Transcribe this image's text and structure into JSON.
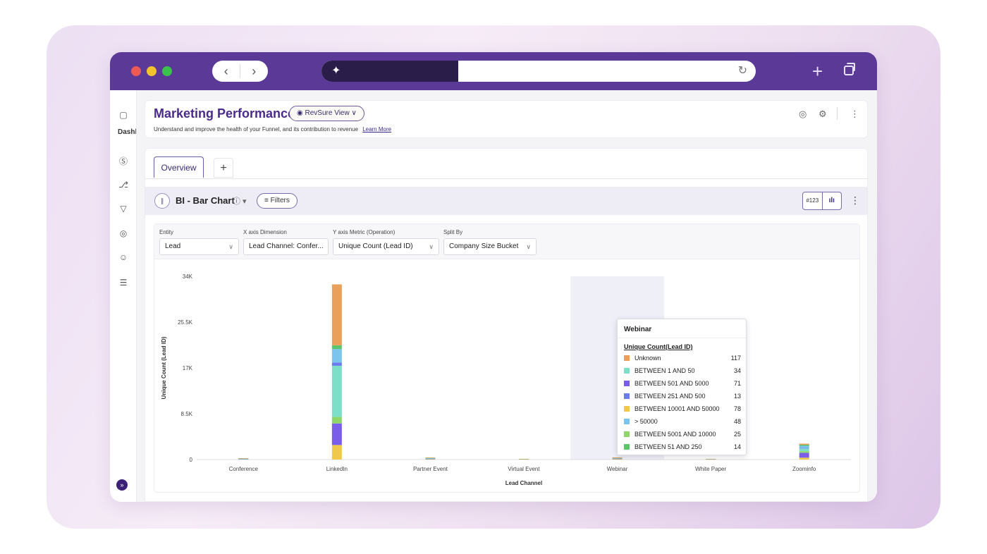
{
  "app": {
    "title": "Marketing Performance",
    "view_pill": "RevSure View",
    "subtitle": "Understand and improve the health of your Funnel, and its contribution to revenue",
    "learn_more": "Learn More"
  },
  "sidebar": {
    "label": "Dashl",
    "icons": [
      "home-icon",
      "dollar-icon",
      "branch-icon",
      "filter-icon",
      "target-icon",
      "users-icon",
      "database-icon",
      "expand-icon"
    ]
  },
  "tabs": [
    {
      "label": "Overview",
      "active": true
    },
    {
      "label": "+",
      "active": false
    }
  ],
  "chart_header": {
    "title": "BI - Bar Chart",
    "filters_label": "Filters",
    "toggle_number": "#123",
    "toggle_chart": "ılı"
  },
  "controls": {
    "entity": {
      "label": "Entity",
      "value": "Lead"
    },
    "x_axis": {
      "label": "X axis Dimension",
      "value": "Lead Channel: Confer..."
    },
    "y_axis": {
      "label": "Y axis Metric (Operation)",
      "value": "Unique Count (Lead ID)"
    },
    "split": {
      "label": "Split By",
      "value": "Company Size Bucket"
    }
  },
  "tooltip": {
    "title": "Webinar",
    "metric": "Unique Count(Lead ID)",
    "rows": [
      {
        "name": "Unknown",
        "value": "117",
        "color": "#e9a05a"
      },
      {
        "name": "BETWEEN 1 AND 50",
        "value": "34",
        "color": "#7ddfc8"
      },
      {
        "name": "BETWEEN 501 AND 5000",
        "value": "71",
        "color": "#7a5de8"
      },
      {
        "name": "BETWEEN 251 AND 500",
        "value": "13",
        "color": "#6a7bee"
      },
      {
        "name": "BETWEEN 10001 AND 50000",
        "value": "78",
        "color": "#f0c94a"
      },
      {
        "name": "> 50000",
        "value": "48",
        "color": "#7ac4ee"
      },
      {
        "name": "BETWEEN 5001 AND 10000",
        "value": "25",
        "color": "#8ed66a"
      },
      {
        "name": "BETWEEN 51 AND 250",
        "value": "14",
        "color": "#5cc46a"
      }
    ]
  },
  "colors": {
    "brand": "#5b3a97",
    "accent": "#4a2a8a",
    "highlight_band": "#efeff8"
  },
  "chart_data": {
    "type": "bar",
    "stacked": true,
    "xlabel": "Lead Channel",
    "ylabel": "Unique Count (Lead ID)",
    "ylim": [
      0,
      34000
    ],
    "yticks": [
      "0",
      "8.5K",
      "17K",
      "25.5K",
      "34K"
    ],
    "ytick_values": [
      0,
      8500,
      17000,
      25500,
      34000
    ],
    "categories": [
      "Conference",
      "LinkedIn",
      "Partner Event",
      "Virtual Event",
      "Webinar",
      "White Paper",
      "Zoominfo"
    ],
    "highlighted_category": "Webinar",
    "series": [
      {
        "name": "BETWEEN 10001 AND 50000",
        "color": "#f0c94a",
        "values": [
          20,
          2700,
          40,
          5,
          78,
          10,
          350
        ]
      },
      {
        "name": "BETWEEN 501 AND 5000",
        "color": "#7a5de8",
        "values": [
          30,
          4000,
          60,
          8,
          71,
          10,
          900
        ]
      },
      {
        "name": "BETWEEN 5001 AND 10000",
        "color": "#8ed66a",
        "values": [
          10,
          1200,
          30,
          2,
          25,
          5,
          300
        ]
      },
      {
        "name": "BETWEEN 1 AND 50",
        "color": "#7ddfc8",
        "values": [
          40,
          9500,
          80,
          10,
          34,
          10,
          500
        ]
      },
      {
        "name": "BETWEEN 251 AND 500",
        "color": "#6a7bee",
        "values": [
          10,
          600,
          20,
          2,
          13,
          3,
          100
        ]
      },
      {
        "name": "> 50000",
        "color": "#7ac4ee",
        "values": [
          30,
          2500,
          40,
          5,
          48,
          10,
          400
        ]
      },
      {
        "name": "BETWEEN 51 AND 250",
        "color": "#5cc46a",
        "values": [
          10,
          700,
          20,
          3,
          14,
          5,
          200
        ]
      },
      {
        "name": "Unknown",
        "color": "#e9a05a",
        "values": [
          10,
          11300,
          40,
          3,
          117,
          5,
          200
        ]
      }
    ]
  }
}
